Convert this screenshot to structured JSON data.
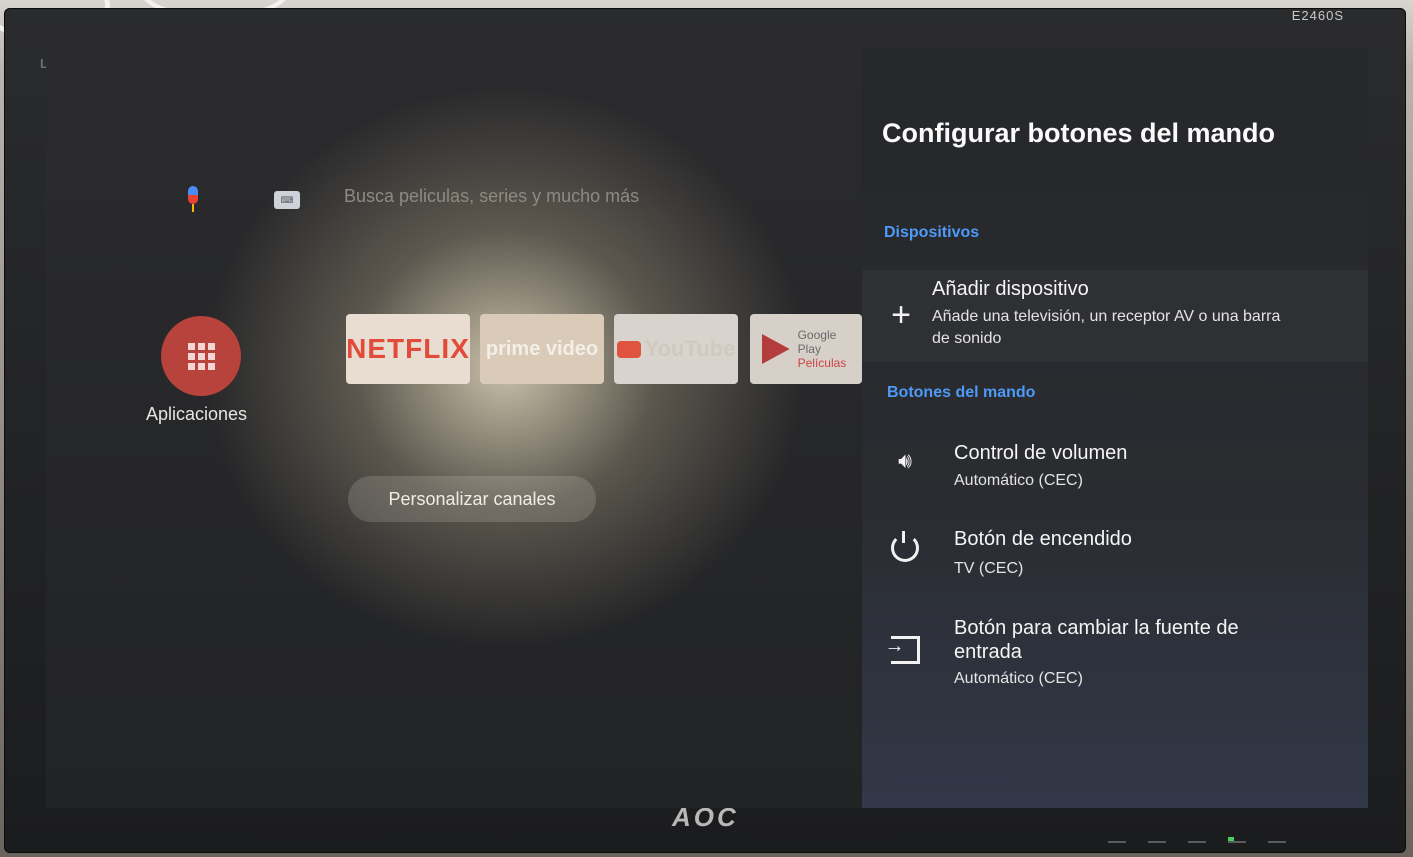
{
  "monitor": {
    "model": "E2460S",
    "led_label": "LED",
    "brand": "AOC"
  },
  "home": {
    "search_placeholder": "Busca peliculas, series y mucho más",
    "apps_label": "Aplicaciones",
    "tiles": {
      "netflix": "NETFLIX",
      "prime": "prime video",
      "youtube": "YouTube",
      "google_play": "Google Play",
      "google_play_sub": "Películas"
    },
    "customize_channels": "Personalizar canales"
  },
  "panel": {
    "title": "Configurar botones del mando",
    "devices_section": "Dispositivos",
    "add_device": {
      "title": "Añadir dispositivo",
      "subtitle": "Añade una televisión, un receptor AV o una barra de sonido"
    },
    "buttons_section": "Botones del mando",
    "items": {
      "volume": {
        "title": "Control de volumen",
        "subtitle": "Automático (CEC)"
      },
      "power": {
        "title": "Botón de encendido",
        "subtitle": "TV (CEC)"
      },
      "input": {
        "title": "Botón para cambiar la fuente de entrada",
        "subtitle": "Automático (CEC)"
      }
    }
  },
  "colors": {
    "accent": "#4d9bf7",
    "apps_button": "#b8433c",
    "netflix": "#e24a3a"
  },
  "icons": {
    "mic": "mic-icon",
    "keyboard": "keyboard-icon",
    "add": "plus-icon",
    "volume": "volume-icon",
    "power": "power-icon",
    "input": "input-source-icon"
  }
}
